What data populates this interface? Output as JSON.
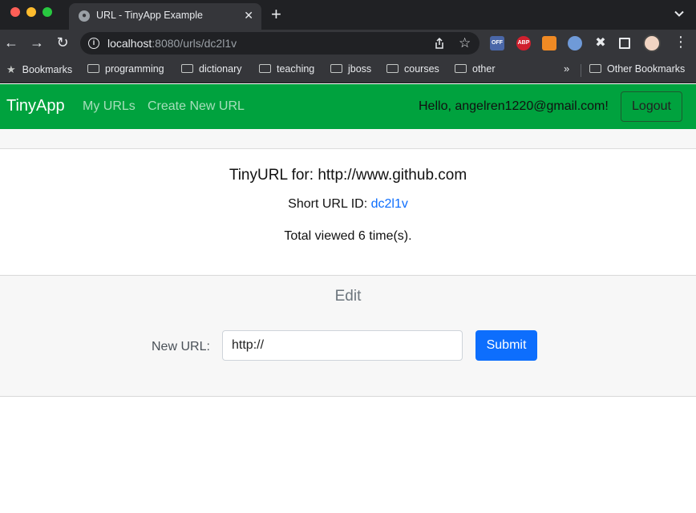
{
  "browser": {
    "tab_title": "URL - TinyApp Example",
    "url_host": "localhost",
    "url_rest": ":8080/urls/dc2l1v",
    "extensions": [
      "OFF",
      "ABP",
      "rss-icon",
      "chrome-icon",
      "puzzle-icon",
      "sidepanel-icon"
    ],
    "bookmarks": [
      "Bookmarks",
      "programming",
      "dictionary",
      "teaching",
      "jboss",
      "courses",
      "other"
    ],
    "overflow": "»",
    "other_bookmarks": "Other Bookmarks"
  },
  "navbar": {
    "brand": "TinyApp",
    "links": [
      "My URLs",
      "Create New URL"
    ],
    "greeting": "Hello, angelren1220@gmail.com!",
    "logout_label": "Logout",
    "color": "#00a23e"
  },
  "url_card": {
    "title": "TinyURL for: http://www.github.com",
    "short_label": "Short URL ID: ",
    "short_id": "dc2l1v",
    "views": "Total viewed 6 time(s)."
  },
  "edit": {
    "title": "Edit",
    "label": "New URL:",
    "input_value": "http://",
    "submit_label": "Submit",
    "accent": "#0d6efd"
  }
}
